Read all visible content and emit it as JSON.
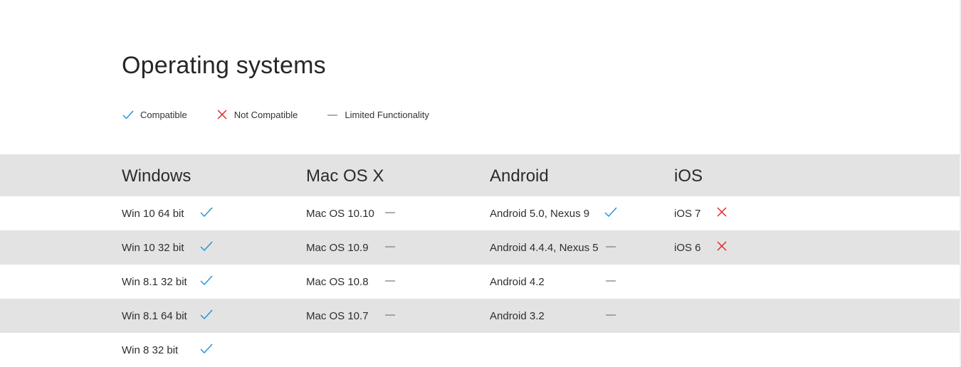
{
  "title": "Operating systems",
  "colors": {
    "compatible": "#1f8fd6",
    "not_compatible": "#e0242b",
    "limited": "#8a8a8a",
    "stripe": "#e3e3e3"
  },
  "legend": [
    {
      "icon": "check-icon",
      "label": "Compatible"
    },
    {
      "icon": "cross-icon",
      "label": "Not Compatible"
    },
    {
      "icon": "dash-icon",
      "label": "Limited Functionality"
    }
  ],
  "columns": [
    "Windows",
    "Mac OS X",
    "Android",
    "iOS"
  ],
  "rows": [
    [
      {
        "name": "Win 10 64 bit",
        "status": "compatible"
      },
      {
        "name": "Mac OS 10.10",
        "status": "limited"
      },
      {
        "name": "Android 5.0, Nexus 9",
        "status": "compatible"
      },
      {
        "name": "iOS 7",
        "status": "not_compatible"
      }
    ],
    [
      {
        "name": "Win 10 32 bit",
        "status": "compatible"
      },
      {
        "name": "Mac OS 10.9",
        "status": "limited"
      },
      {
        "name": "Android 4.4.4, Nexus 5",
        "status": "limited"
      },
      {
        "name": "iOS 6",
        "status": "not_compatible"
      }
    ],
    [
      {
        "name": "Win 8.1 32 bit",
        "status": "compatible"
      },
      {
        "name": "Mac OS 10.8",
        "status": "limited"
      },
      {
        "name": "Android 4.2",
        "status": "limited"
      },
      null
    ],
    [
      {
        "name": "Win 8.1 64 bit",
        "status": "compatible"
      },
      {
        "name": "Mac OS 10.7",
        "status": "limited"
      },
      {
        "name": "Android 3.2",
        "status": "limited"
      },
      null
    ],
    [
      {
        "name": "Win 8 32 bit",
        "status": "compatible"
      },
      null,
      null,
      null
    ]
  ]
}
